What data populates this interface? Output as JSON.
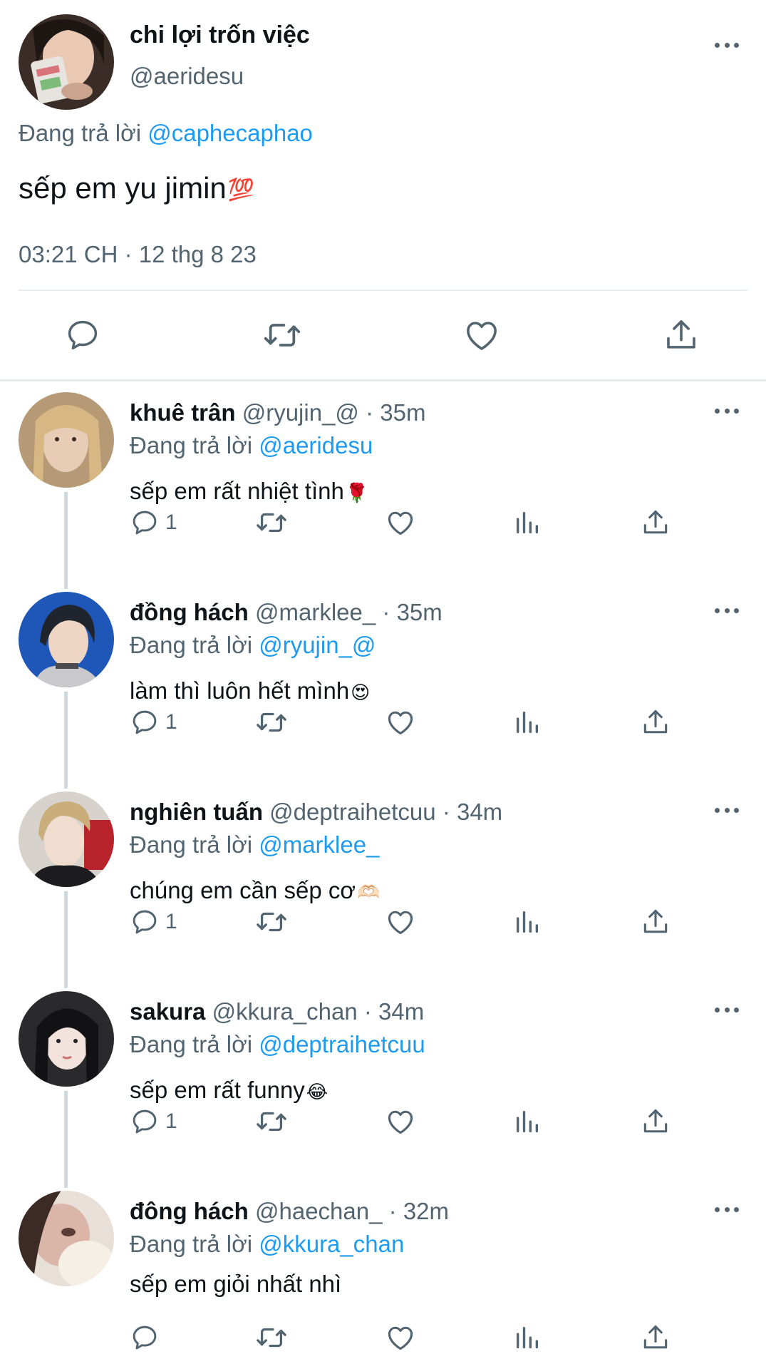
{
  "main_tweet": {
    "display_name": "chi lợi trốn việc",
    "handle": "@aeridesu",
    "replying_prefix": "Đang trả lời",
    "replying_to": "@caphecaphao",
    "text": "sếp em yu jimin",
    "emoji": "💯",
    "timestamp": "03:21 CH · 12 thg 8 23",
    "actions": [
      "reply-icon",
      "retweet-icon",
      "like-icon",
      "share-icon"
    ]
  },
  "replies": [
    {
      "display_name": "khuê trân",
      "handle": "@ryujin_@",
      "time": "· 35m",
      "replying_prefix": "Đang trả lời",
      "replying_to": "@aeridesu",
      "text": "sếp em rất nhiệt tình",
      "emoji": "🌹",
      "reply_count": "1"
    },
    {
      "display_name": "đồng hách",
      "handle": "@marklee_",
      "time": "· 35m",
      "replying_prefix": "Đang trả lời",
      "replying_to": "@ryujin_@",
      "text": "làm thì luôn hết mình",
      "emoji": "😍",
      "reply_count": "1"
    },
    {
      "display_name": "nghiên tuấn",
      "handle": "@deptraihetcuu",
      "time": "· 34m",
      "replying_prefix": "Đang trả lời",
      "replying_to": "@marklee_",
      "text": "chúng em cần sếp cơ",
      "emoji": "🫶🏻",
      "reply_count": "1"
    },
    {
      "display_name": "sakura",
      "handle": "@kkura_chan",
      "time": "· 34m",
      "replying_prefix": "Đang trả lời",
      "replying_to": "@deptraihetcuu",
      "text": "sếp em rất funny",
      "emoji": "😂",
      "reply_count": "1"
    },
    {
      "display_name": "đông hách",
      "handle": "@haechan_",
      "time": "· 32m",
      "replying_prefix": "Đang trả lời",
      "replying_to": "@kkura_chan",
      "text": "sếp em giỏi nhất nhì",
      "emoji": "",
      "reply_count": ""
    }
  ],
  "colors": {
    "text_primary": "#0f1419",
    "text_secondary": "#536471",
    "link": "#1d9bf0",
    "divider": "#e6ecf0",
    "thread_line": "#cfd9de"
  }
}
